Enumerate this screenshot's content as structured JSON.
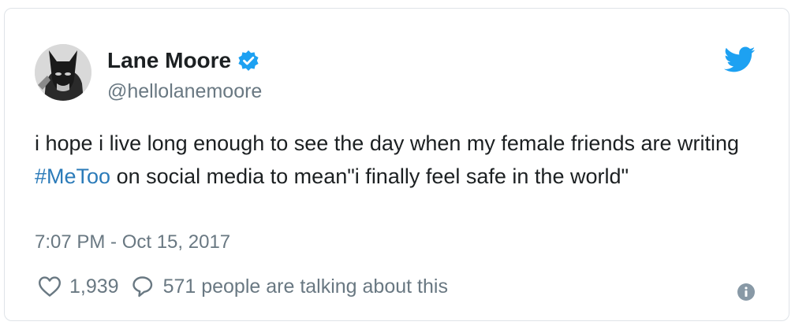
{
  "author": {
    "name": "Lane Moore",
    "handle": "@hellolanemoore",
    "verified": true,
    "avatar_icon": "batman-avatar"
  },
  "tweet": {
    "text_before_hashtag": "i hope i live long enough to see the day when my female friends are writing ",
    "hashtag": "#MeToo",
    "text_after_hashtag": " on social media to mean\"i finally feel safe in the world\"",
    "timestamp": "7:07 PM - Oct 15, 2017"
  },
  "actions": {
    "like_count": "1,939",
    "talking_label": "571 people are talking about this"
  },
  "icons": {
    "brand": "twitter-bird-icon",
    "verified": "verified-badge-icon",
    "like": "heart-icon",
    "reply": "speech-bubble-icon",
    "info": "info-icon"
  },
  "colors": {
    "brand_blue": "#1da1f2",
    "hashtag_blue": "#2b7bb9",
    "muted_gray": "#697882",
    "text_dark": "#1c2022"
  }
}
